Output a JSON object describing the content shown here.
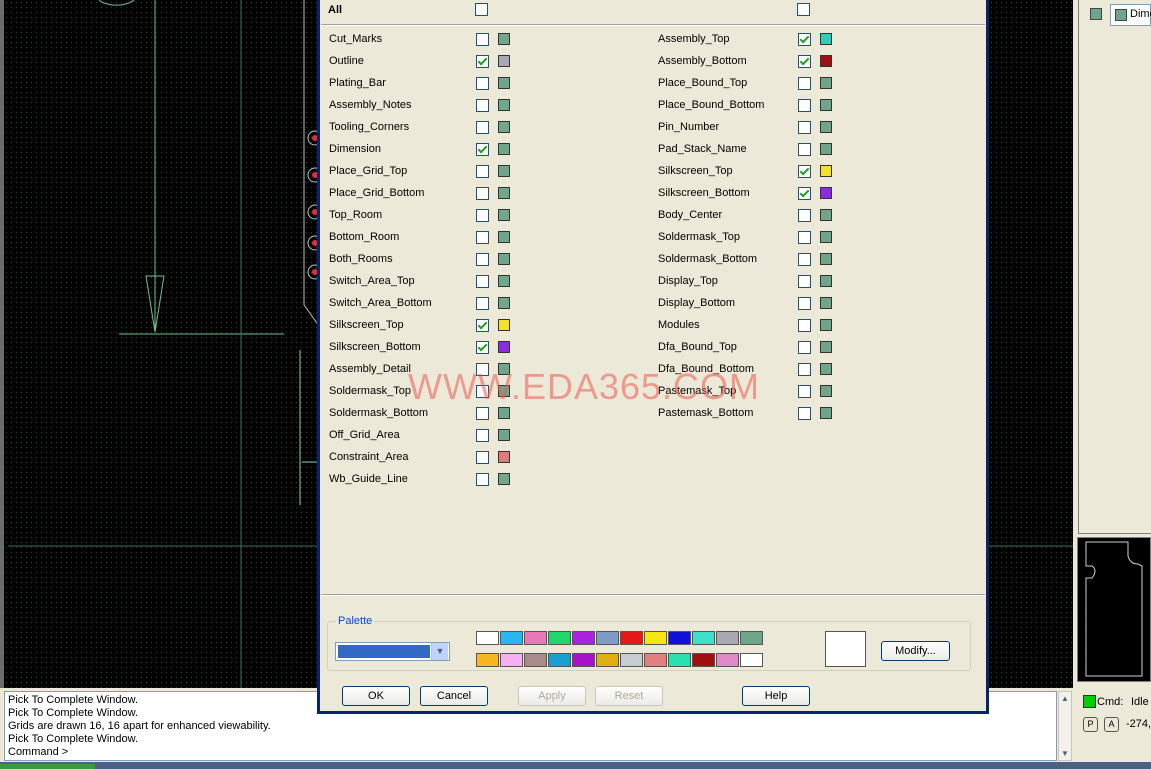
{
  "dialog": {
    "all_label": "All",
    "left_rows": [
      {
        "label": "Cut_Marks",
        "checked": false,
        "color": "#6fa58a"
      },
      {
        "label": "Outline",
        "checked": true,
        "color": "#a8a8b8"
      },
      {
        "label": "Plating_Bar",
        "checked": false,
        "color": "#6fa58a"
      },
      {
        "label": "Assembly_Notes",
        "checked": false,
        "color": "#6fa58a"
      },
      {
        "label": "Tooling_Corners",
        "checked": false,
        "color": "#6fa58a"
      },
      {
        "label": "Dimension",
        "checked": true,
        "color": "#6fa58a"
      },
      {
        "label": "Place_Grid_Top",
        "checked": false,
        "color": "#6fa58a"
      },
      {
        "label": "Place_Grid_Bottom",
        "checked": false,
        "color": "#6fa58a"
      },
      {
        "label": "Top_Room",
        "checked": false,
        "color": "#6fa58a"
      },
      {
        "label": "Bottom_Room",
        "checked": false,
        "color": "#6fa58a"
      },
      {
        "label": "Both_Rooms",
        "checked": false,
        "color": "#6fa58a"
      },
      {
        "label": "Switch_Area_Top",
        "checked": false,
        "color": "#6fa58a"
      },
      {
        "label": "Switch_Area_Bottom",
        "checked": false,
        "color": "#6fa58a"
      },
      {
        "label": "Silkscreen_Top",
        "checked": true,
        "color": "#f5e12a"
      },
      {
        "label": "Silkscreen_Bottom",
        "checked": true,
        "color": "#8a2be2"
      },
      {
        "label": "Assembly_Detail",
        "checked": false,
        "color": "#6fa58a"
      },
      {
        "label": "Soldermask_Top",
        "checked": false,
        "color": "#6fa58a"
      },
      {
        "label": "Soldermask_Bottom",
        "checked": false,
        "color": "#6fa58a"
      },
      {
        "label": "Off_Grid_Area",
        "checked": false,
        "color": "#6fa58a"
      },
      {
        "label": "Constraint_Area",
        "checked": false,
        "color": "#e07b7b"
      },
      {
        "label": "Wb_Guide_Line",
        "checked": false,
        "color": "#6fa58a"
      }
    ],
    "right_rows": [
      {
        "label": "Assembly_Top",
        "checked": true,
        "color": "#2ecfb8"
      },
      {
        "label": "Assembly_Bottom",
        "checked": true,
        "color": "#a01010"
      },
      {
        "label": "Place_Bound_Top",
        "checked": false,
        "color": "#6fa58a"
      },
      {
        "label": "Place_Bound_Bottom",
        "checked": false,
        "color": "#6fa58a"
      },
      {
        "label": "Pin_Number",
        "checked": false,
        "color": "#6fa58a"
      },
      {
        "label": "Pad_Stack_Name",
        "checked": false,
        "color": "#6fa58a"
      },
      {
        "label": "Silkscreen_Top",
        "checked": true,
        "color": "#f5e12a"
      },
      {
        "label": "Silkscreen_Bottom",
        "checked": true,
        "color": "#8a2be2"
      },
      {
        "label": "Body_Center",
        "checked": false,
        "color": "#6fa58a"
      },
      {
        "label": "Soldermask_Top",
        "checked": false,
        "color": "#6fa58a"
      },
      {
        "label": "Soldermask_Bottom",
        "checked": false,
        "color": "#6fa58a"
      },
      {
        "label": "Display_Top",
        "checked": false,
        "color": "#6fa58a"
      },
      {
        "label": "Display_Bottom",
        "checked": false,
        "color": "#6fa58a"
      },
      {
        "label": "Modules",
        "checked": false,
        "color": "#6fa58a"
      },
      {
        "label": "Dfa_Bound_Top",
        "checked": false,
        "color": "#6fa58a"
      },
      {
        "label": "Dfa_Bound_Bottom",
        "checked": false,
        "color": "#6fa58a"
      },
      {
        "label": "Pastemask_Top",
        "checked": false,
        "color": "#6fa58a"
      },
      {
        "label": "Pastemask_Bottom",
        "checked": false,
        "color": "#6fa58a"
      }
    ],
    "palette": {
      "label": "Palette",
      "selected_color": "#316ac5",
      "row1": [
        "#ffffff",
        "#2ab6f0",
        "#e879b8",
        "#22d66e",
        "#a822e0",
        "#7e9cc4",
        "#e81818",
        "#f5e612",
        "#1010d8",
        "#3ee0cc",
        "#a8a8b0",
        "#6fa58a"
      ],
      "row2": [
        "#f5b820",
        "#f4b0f0",
        "#a88c8c",
        "#18a0d0",
        "#a812c8",
        "#e0b010",
        "#c8ccd0",
        "#e08080",
        "#28e0b0",
        "#a01010",
        "#e088c8",
        "#ffffff"
      ],
      "current_color": "#ffffff",
      "modify_label": "Modify..."
    },
    "buttons": {
      "ok": "OK",
      "cancel": "Cancel",
      "apply": "Apply",
      "reset": "Reset",
      "help": "Help"
    }
  },
  "watermark": "WWW.EDA365.COM",
  "console": {
    "lines": [
      "Pick To Complete Window.",
      "Pick To Complete Window.",
      "Grids are drawn 16, 16 apart for enhanced viewability.",
      "Pick To Complete Window.",
      "Command >"
    ]
  },
  "status": {
    "cmd_label": "Cmd:",
    "cmd_value": "Idle",
    "p_label": "P",
    "a_label": "A",
    "coord": "-274,"
  },
  "right_panel": {
    "field_text": "Dime"
  }
}
